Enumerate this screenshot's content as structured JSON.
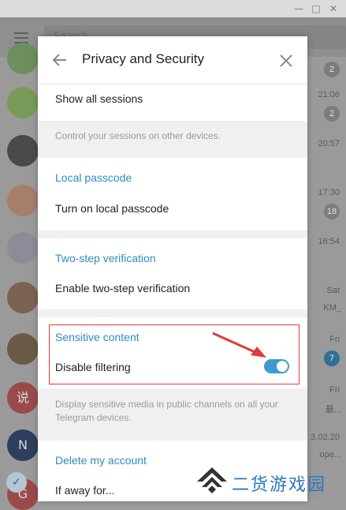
{
  "window": {
    "minimize_icon": "minimize-icon",
    "maximize_icon": "maximize-icon",
    "close_icon": "close-icon"
  },
  "app": {
    "search_placeholder": "Search",
    "chats": [
      {
        "time": "",
        "badge": "2",
        "avatar_color": "#6d8f5e"
      },
      {
        "time": "21:06",
        "badge": "2",
        "avatar_color": "#7a9a5a"
      },
      {
        "time": "20:57",
        "badge": "",
        "avatar_color": "#4a4a4a"
      },
      {
        "time": "17:30",
        "badge": "18",
        "avatar_color": "#a57f6a"
      },
      {
        "time": "16:54",
        "badge": "",
        "avatar_color": "#8c8c98"
      },
      {
        "time": "Sat",
        "snippet": "KM_",
        "badge": "",
        "avatar_color": "#7c6253"
      },
      {
        "time": "Fri",
        "badge": "7",
        "avatar_color": "#6b5a46"
      },
      {
        "time": "Fri",
        "snippet": "最...",
        "badge": "",
        "avatar_color": "#9b4a4a",
        "avatar_text": "说"
      },
      {
        "time": "3.02.20",
        "snippet": "ope...",
        "badge": "",
        "avatar_color": "#2d3f5c",
        "avatar_text": "N"
      },
      {
        "time": "",
        "badge": "",
        "avatar_color": "#9b4a4a",
        "avatar_text": "G"
      }
    ]
  },
  "modal": {
    "title": "Privacy and Security",
    "show_all_sessions": "Show all sessions",
    "sessions_note": "Control your sessions on other devices.",
    "local_passcode": {
      "title": "Local passcode",
      "action": "Turn on local passcode"
    },
    "two_step": {
      "title": "Two-step verification",
      "action": "Enable two-step verification"
    },
    "sensitive": {
      "title": "Sensitive content",
      "action": "Disable filtering",
      "toggle_on": true,
      "note": "Display sensitive media in public channels on all your Telegram devices."
    },
    "delete_account": {
      "title": "Delete my account",
      "action": "If away for..."
    }
  },
  "annotation": {
    "highlight_color": "#e03a3a",
    "arrow_color": "#e03a3a"
  },
  "watermark": {
    "text": "二货游戏园"
  },
  "colors": {
    "accent": "#2f8bbf",
    "toggle_on": "#3b9ccf"
  }
}
